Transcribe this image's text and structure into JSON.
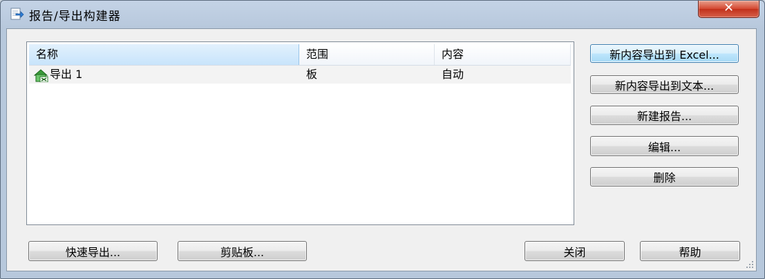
{
  "window": {
    "title": "报告/导出构建器",
    "close_glyph": "✕"
  },
  "list": {
    "columns": [
      "名称",
      "范围",
      "内容"
    ],
    "rows": [
      {
        "name": "导出 1",
        "scope": "板",
        "content": "自动",
        "icon": "export-icon"
      }
    ]
  },
  "side_buttons": {
    "export_excel": "新内容导出到 Excel...",
    "export_text": "新内容导出到文本...",
    "new_report": "新建报告...",
    "edit": "编辑...",
    "delete": "删除"
  },
  "bottom_buttons": {
    "quick_export": "快速导出...",
    "clipboard": "剪贴板...",
    "close": "关闭",
    "help": "帮助"
  },
  "colors": {
    "accent_default_button": "#bee6fd",
    "close_button": "#c1301b",
    "title_bar": "#c4d3e6"
  }
}
